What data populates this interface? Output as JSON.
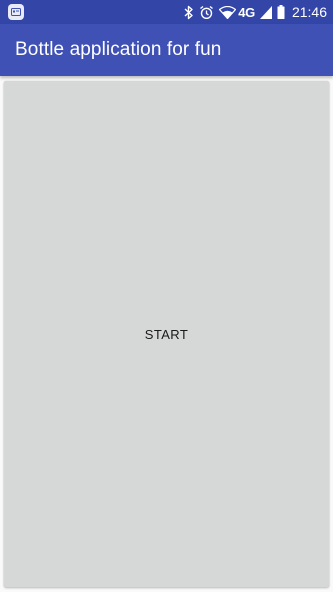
{
  "status_bar": {
    "network": "4G",
    "time": "21:46",
    "icons": [
      "app-notification-icon",
      "bluetooth-icon",
      "alarm-icon",
      "wifi-icon",
      "cell-signal-icon",
      "battery-icon"
    ]
  },
  "app_bar": {
    "title": "Bottle application for fun"
  },
  "main": {
    "start_label": "START"
  },
  "colors": {
    "status_bar": "#3346a8",
    "app_bar": "#3f51b5",
    "button_bg": "#d6d7d7"
  }
}
